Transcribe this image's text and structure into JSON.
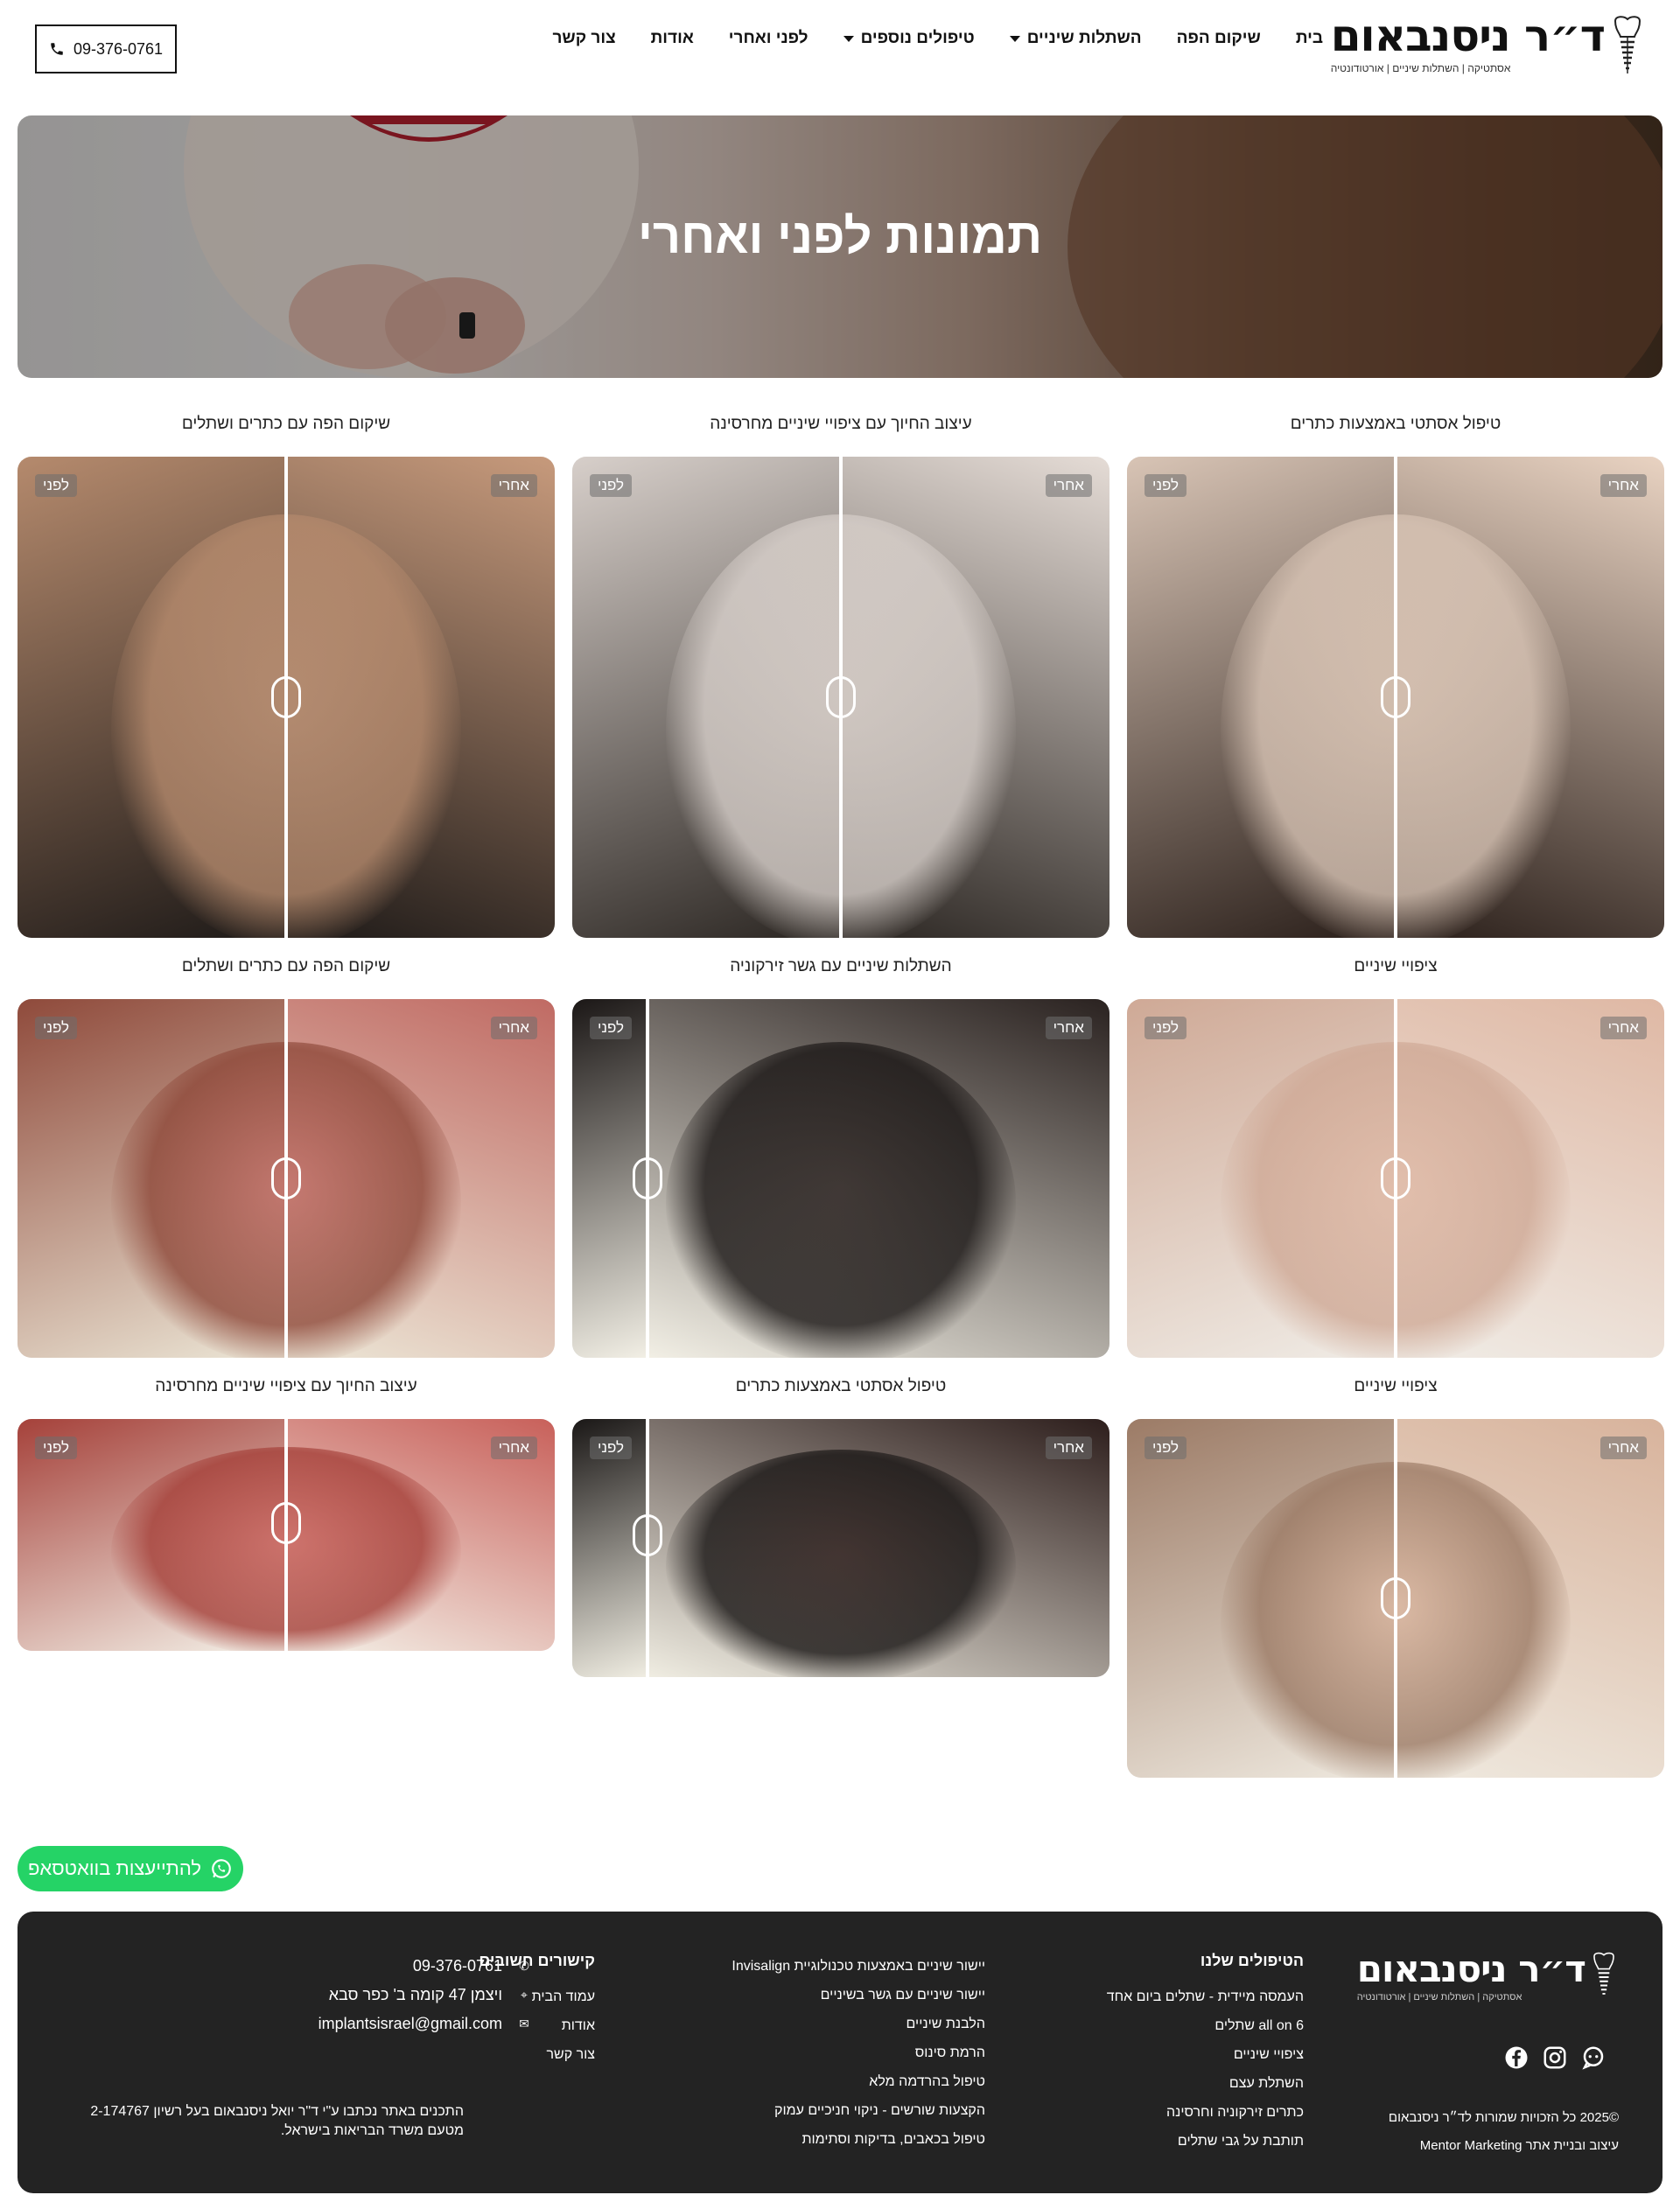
{
  "header": {
    "logo_name": "ד״ר ניסנבאום",
    "logo_tagline": "אסתטיקה | השתלות שיניים | אורטודונטיה",
    "nav": [
      {
        "label": "בית"
      },
      {
        "label": "שיקום הפה"
      },
      {
        "label": "השתלות שיניים",
        "has_dropdown": true
      },
      {
        "label": "טיפולים נוספים",
        "has_dropdown": true
      },
      {
        "label": "לפני ואחרי"
      },
      {
        "label": "אודות"
      },
      {
        "label": "צור קשר"
      }
    ],
    "phone": "09-376-0761"
  },
  "hero": {
    "title": "תמונות לפני ואחרי"
  },
  "gallery": {
    "before_label": "לפני",
    "after_label": "אחרי",
    "items": [
      {
        "caption": "טיפול אסתטי באמצעות כתרים",
        "slider_position": 0.5
      },
      {
        "caption": "עיצוב החיוך עם ציפויי שיניים מחרסינה",
        "slider_position": 0.5
      },
      {
        "caption": "שיקום הפה עם כתרים ושתלים",
        "slider_position": 0.5
      },
      {
        "caption": "ציפויי שיניים",
        "slider_position": 0.5
      },
      {
        "caption": "השתלות שיניים עם גשר זירקוניה",
        "slider_position": 0.14
      },
      {
        "caption": "שיקום הפה עם כתרים ושתלים",
        "slider_position": 0.5
      },
      {
        "caption": "ציפויי שיניים",
        "slider_position": 0.5
      },
      {
        "caption": "טיפול אסתטי באמצעות כתרים",
        "slider_position": 0.14
      },
      {
        "caption": "עיצוב החיוך עם ציפויי שיניים מחרסינה",
        "slider_position": 0.5
      }
    ]
  },
  "whatsapp": {
    "label": "להתייעצות בוואטסאפ"
  },
  "footer": {
    "logo_name": "ד״ר ניסנבאום",
    "logo_tagline": "אסתטיקה | השתלות שיניים | אורטודונטיה",
    "copyright": "©2025 כל הזכויות שמורות לד״ר ניסנבאום",
    "credit": "עיצוב ובניית אתר Mentor Marketing",
    "treatments_title": "הטיפולים שלנו",
    "treatments": [
      "העמסה מיידית - שתלים ביום אחד",
      "all on 6 שתלים",
      "ציפויי שיניים",
      "השתלת עצם",
      "כתרים זירקוניה וחרסינה",
      "תותבת על גבי שתלים"
    ],
    "treatments2": [
      "יישור שיניים באמצעות טכנולוגיית Invisalign",
      "יישור שיניים עם גשר בשיניים",
      "הלבנת שיניים",
      "הרמת סינוס",
      "טיפול בהרדמה מלא",
      "הקצעות שורשים - ניקוי חניכיים עמוק",
      "טיפול בכאבים, בדיקות וסתימות"
    ],
    "links_title": "קישורים חשובים",
    "links": [
      "עמוד הבית",
      "אודות",
      "צור קשר"
    ],
    "phone": "09-376-0761",
    "address": "ויצמן 47 קומה ב' כפר סבא",
    "email": "implantsisrael@gmail.com",
    "legal": "התכנים באתר נכתבו ע\"י ד\"ר יואל ניסנבאום בעל רשיון 2-174767 מטעם משרד הבריאות בישראל."
  },
  "colors": {
    "whatsapp_green": "#25d366",
    "footer_bg": "#232323",
    "text_dark": "#111111"
  }
}
